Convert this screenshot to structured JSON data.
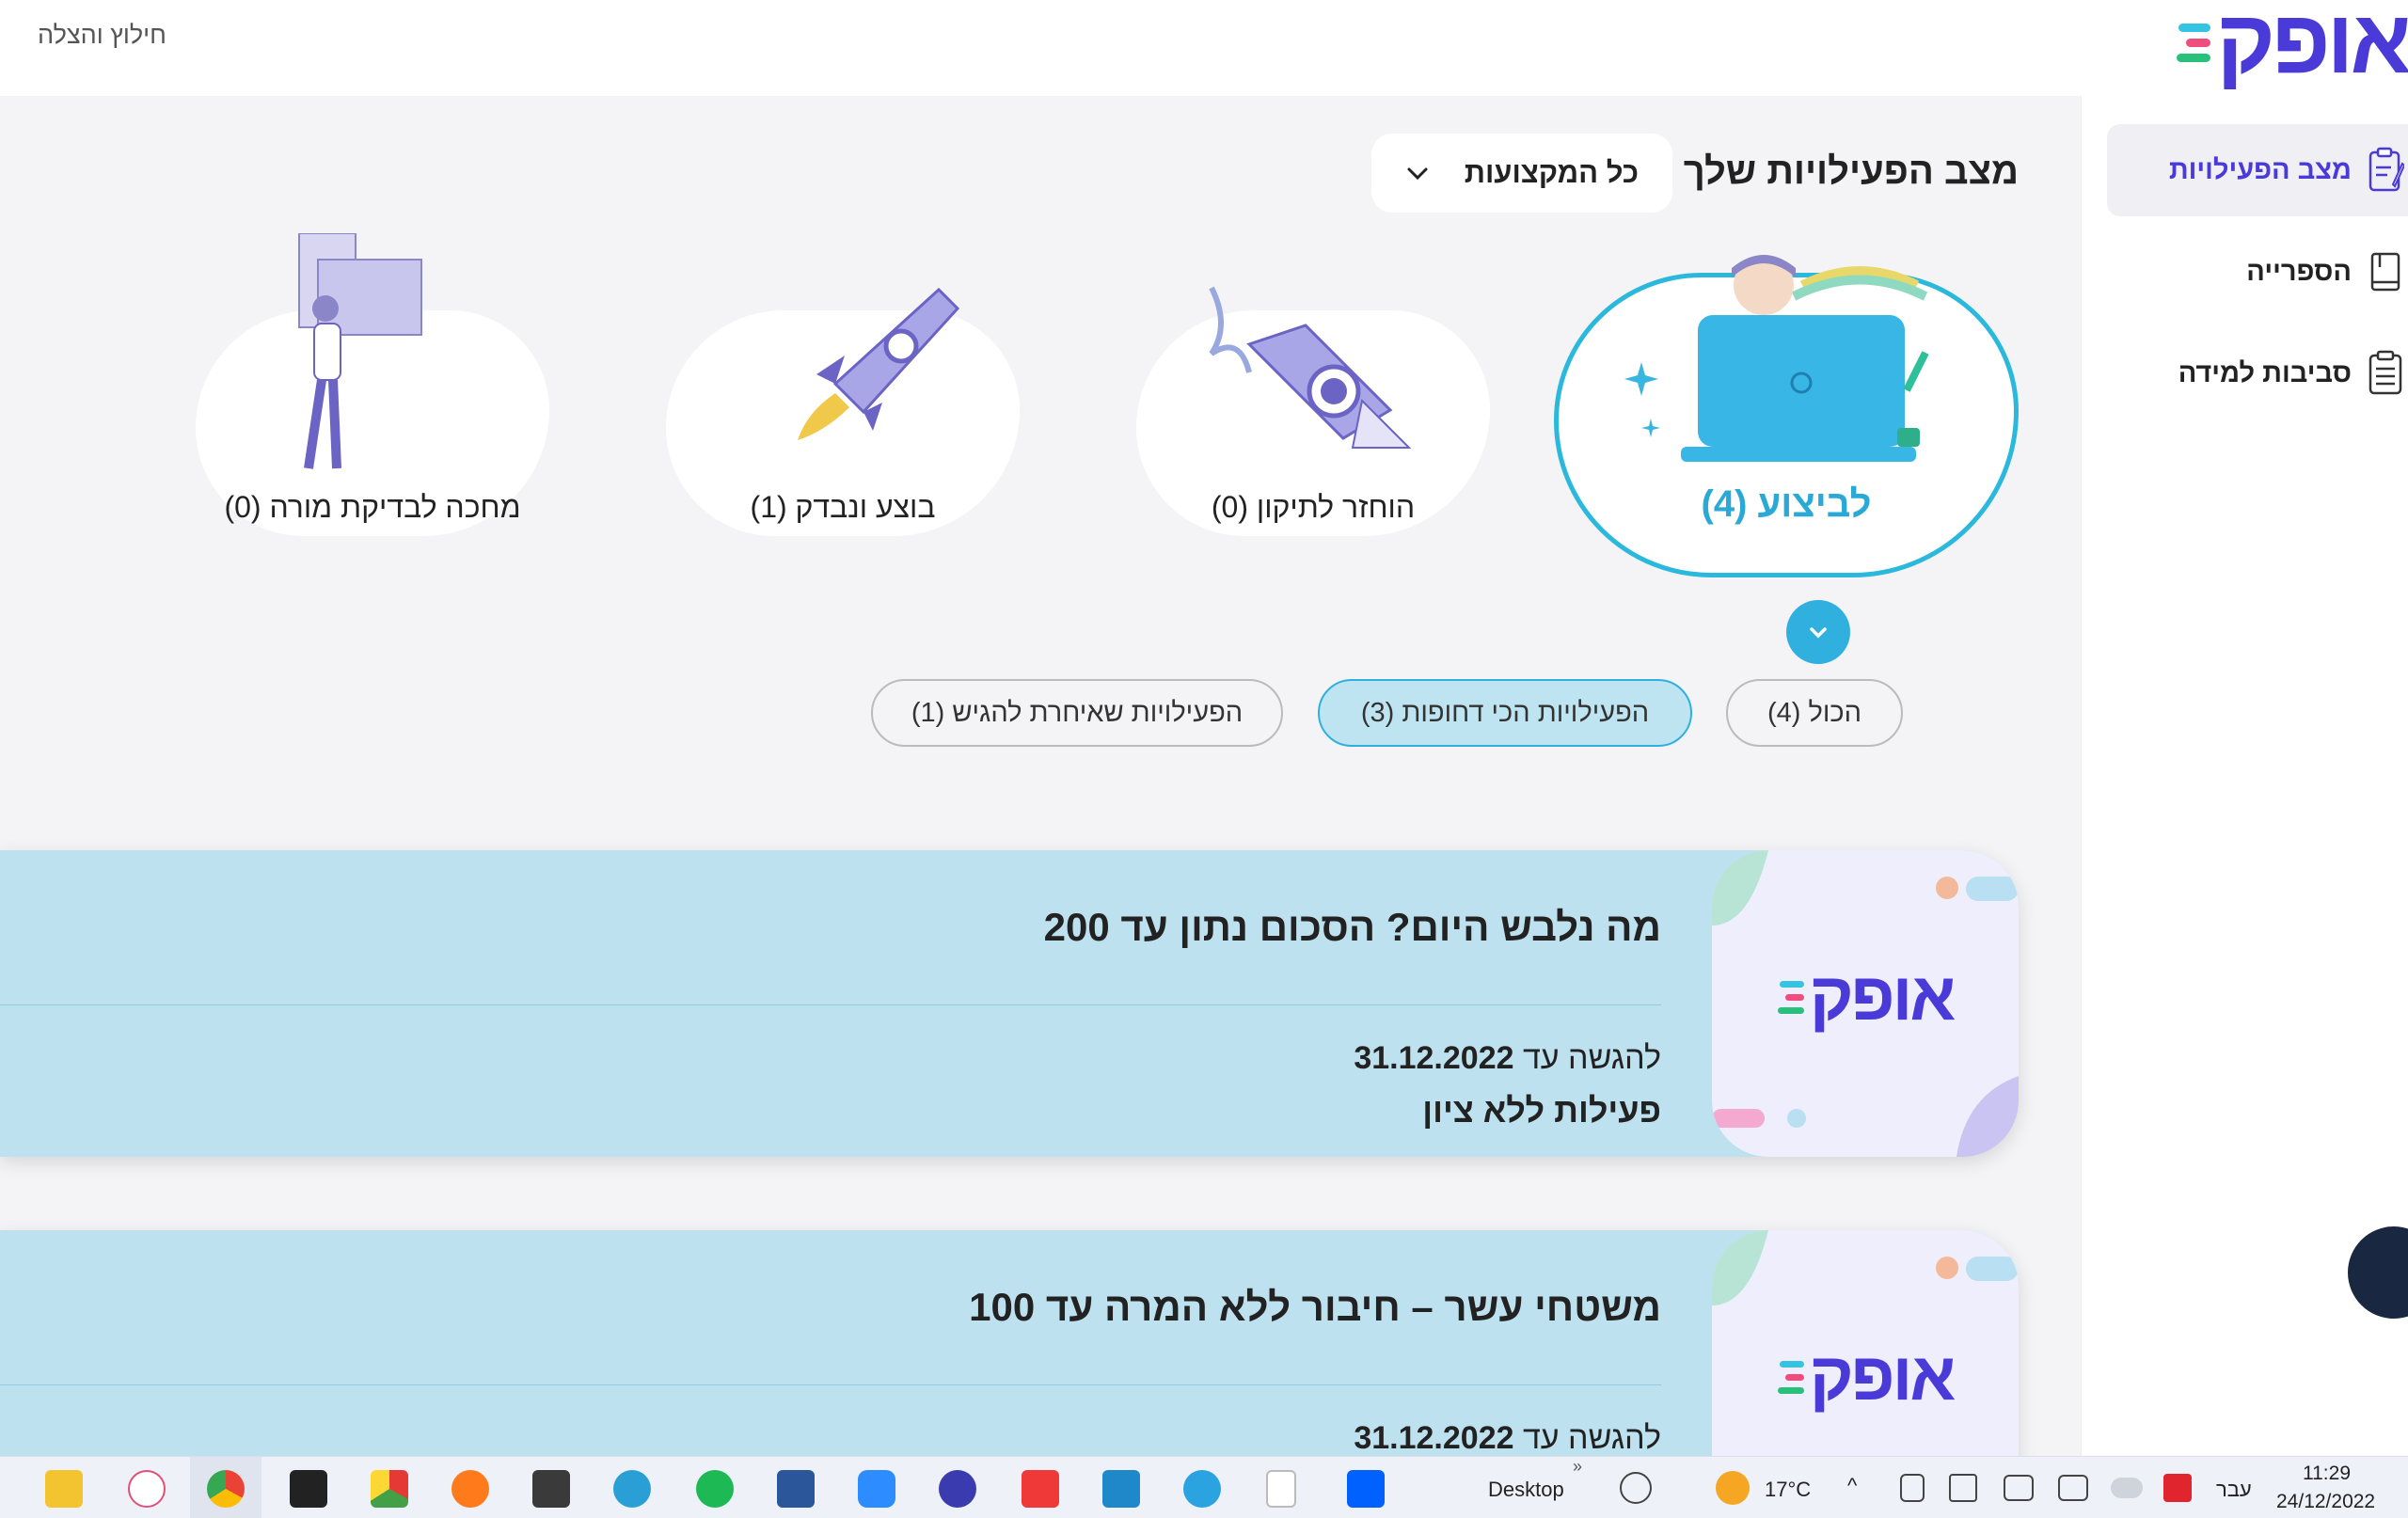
{
  "header": {
    "rescue_link": "חילוץ והצלה",
    "logo_text": "אופק",
    "logo_line_colors": [
      "#34c3e0",
      "#ee4d7e",
      "#28c07a"
    ]
  },
  "sidebar": {
    "items": [
      {
        "label": "מצב הפעילויות",
        "icon": "clipboard-pencil-icon",
        "active": true
      },
      {
        "label": "הספרייה",
        "icon": "book-icon",
        "active": false
      },
      {
        "label": "סביבות למידה",
        "icon": "clipboard-list-icon",
        "active": false
      }
    ]
  },
  "main": {
    "title": "מצב הפעילויות שלך",
    "subject_select": "כל המקצועות",
    "status_cards": [
      {
        "label": "לביצוע (4)",
        "active": true
      },
      {
        "label": "הוחזר לתיקון (0)"
      },
      {
        "label": "בוצע ונבדק (1)"
      },
      {
        "label": "מחכה לבדיקת מורה (0)"
      }
    ],
    "filters": [
      {
        "label": "הכול (4)",
        "active": false
      },
      {
        "label": "הפעילויות הכי דחופות (3)",
        "active": true
      },
      {
        "label": "הפעילויות שאיחרת להגיש (1)",
        "active": false
      }
    ],
    "activities": [
      {
        "title": "מה נלבש היום? הסכום נתון עד 200",
        "due_prefix": "להגשה עד",
        "due_date": "31.12.2022",
        "grade": "פעילות ללא ציון"
      },
      {
        "title": "משטחי עשר – חיבור ללא המרה עד 100",
        "due_prefix": "להגשה עד",
        "due_date": "31.12.2022",
        "grade": ""
      }
    ]
  },
  "taskbar": {
    "desktop_label": "Desktop",
    "weather": "17°C",
    "language": "עבר",
    "time": "11:29",
    "date": "24/12/2022",
    "overflow": "»"
  },
  "colors": {
    "accent": "#4a3bd8",
    "cyan": "#2fb0de",
    "card_bg": "#bee1ef"
  }
}
